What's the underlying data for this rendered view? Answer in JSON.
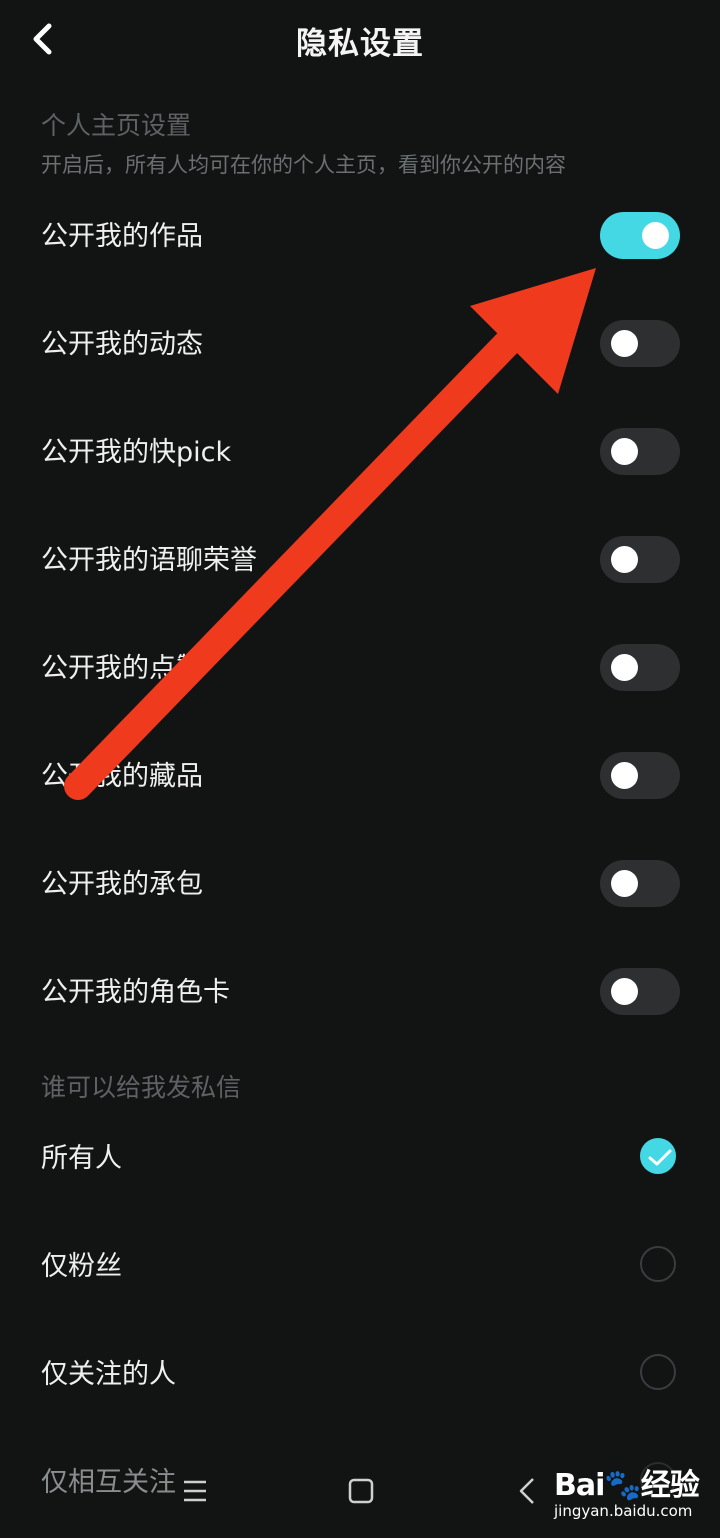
{
  "header": {
    "title": "隐私设置",
    "back_icon": "chevron-left-icon"
  },
  "profile_section": {
    "title": "个人主页设置",
    "subtitle": "开启后，所有人均可在你的个人主页，看到你公开的内容",
    "items": [
      {
        "label": "公开我的作品",
        "on": true
      },
      {
        "label": "公开我的动态",
        "on": false
      },
      {
        "label": "公开我的快pick",
        "on": false
      },
      {
        "label": "公开我的语聊荣誉",
        "on": false
      },
      {
        "label": "公开我的点赞",
        "on": false
      },
      {
        "label": "公开我的藏品",
        "on": false
      },
      {
        "label": "公开我的承包",
        "on": false
      },
      {
        "label": "公开我的角色卡",
        "on": false
      }
    ]
  },
  "message_section": {
    "title": "谁可以给我发私信",
    "options": [
      {
        "label": "所有人",
        "selected": true
      },
      {
        "label": "仅粉丝",
        "selected": false
      },
      {
        "label": "仅关注的人",
        "selected": false
      },
      {
        "label": "仅相互关注",
        "selected": false
      }
    ]
  },
  "colors": {
    "accent": "#43d8e4",
    "background": "#121414",
    "arrow": "#f03a1e",
    "toggle_off": "#2d2f31"
  },
  "navbar": {
    "menu_icon": "menu-icon",
    "home_icon": "square-home-icon",
    "back_icon": "triangle-back-icon"
  },
  "watermark": {
    "logo": "Bai🐾经验",
    "url": "jingyan.baidu.com"
  }
}
